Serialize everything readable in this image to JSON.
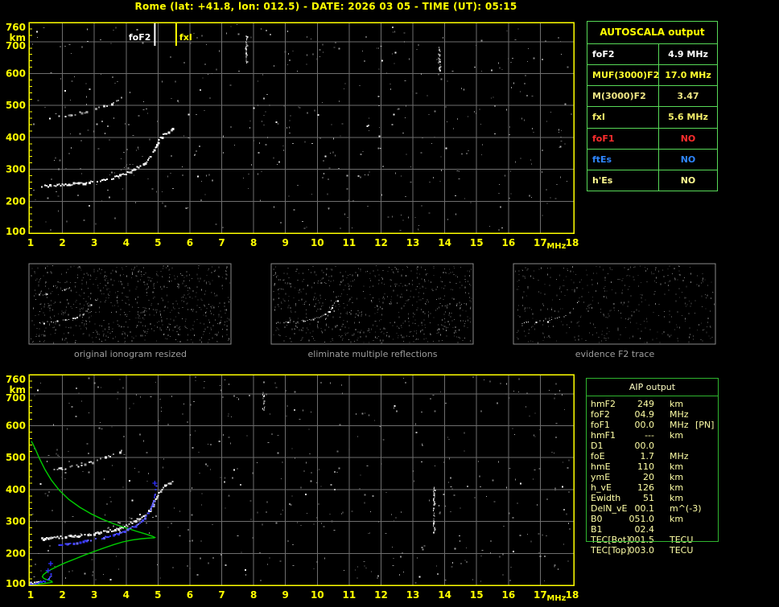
{
  "title": "Rome (lat: +41.8, lon: 012.5) - DATE: 2026 03 05 - TIME (UT): 05:15",
  "colors": {
    "background": "#000000",
    "axis": "#ffff00",
    "grid": "#6e6e6e",
    "trace_white": "#ffffff",
    "trace_gray": "#999999",
    "profile_green": "#00cf00",
    "fitted_blue": "#2f2fff",
    "table_border_autoscala": "#57d957",
    "table_border_aip": "#2fb52f",
    "aip_text": "#ffffa6",
    "caption_gray": "#9e9e9e",
    "foF2_marker": "#ffffff",
    "fxI_marker": "#ffff00"
  },
  "axes": {
    "freq_unit": "MHz",
    "freq_ticks": [
      1,
      2,
      3,
      4,
      5,
      6,
      7,
      8,
      9,
      10,
      11,
      12,
      13,
      14,
      15,
      16,
      17,
      18
    ],
    "height_unit": "km",
    "height_ticks": [
      760,
      700,
      600,
      500,
      400,
      300,
      200,
      100
    ],
    "freq_range": [
      1,
      18
    ],
    "height_range": [
      100,
      760
    ]
  },
  "markers": {
    "foF2": {
      "label": "foF2",
      "freq_mhz": 4.9
    },
    "fxI": {
      "label": "fxI",
      "freq_mhz": 5.57
    }
  },
  "autoscala_table": {
    "header": "AUTOSCALA output",
    "rows": [
      {
        "label": "foF2",
        "value": "4.9 MHz",
        "color": "#ffffff"
      },
      {
        "label": "MUF(3000)F2",
        "value": "17.0 MHz",
        "color": "#ffff2e"
      },
      {
        "label": "M(3000)F2",
        "value": "3.47",
        "color": "#efe685"
      },
      {
        "label": "fxI",
        "value": "5.6 MHz",
        "color": "#f5ef6a"
      },
      {
        "label": "foF1",
        "value": "NO",
        "color": "#ff2d2d"
      },
      {
        "label": "ftEs",
        "value": "NO",
        "color": "#2e86ff"
      },
      {
        "label": "h'Es",
        "value": "NO",
        "color": "#fdf98f"
      }
    ]
  },
  "aip_table": {
    "header": "AIP output",
    "rows": [
      {
        "label": "hmF2",
        "value": "249",
        "unit": "km",
        "extra": ""
      },
      {
        "label": "foF2",
        "value": "04.9",
        "unit": "MHz",
        "extra": ""
      },
      {
        "label": "foF1",
        "value": "00.0",
        "unit": "MHz",
        "extra": "[PN]"
      },
      {
        "label": "hmF1",
        "value": "---",
        "unit": "km",
        "extra": ""
      },
      {
        "label": "D1",
        "value": "00.0",
        "unit": "",
        "extra": ""
      },
      {
        "label": "foE",
        "value": "1.7",
        "unit": "MHz",
        "extra": ""
      },
      {
        "label": "hmE",
        "value": "110",
        "unit": "km",
        "extra": ""
      },
      {
        "label": "ymE",
        "value": "20",
        "unit": "km",
        "extra": ""
      },
      {
        "label": "h_vE",
        "value": "126",
        "unit": "km",
        "extra": ""
      },
      {
        "label": "Ewidth",
        "value": "51",
        "unit": "km",
        "extra": ""
      },
      {
        "label": "DelN_vE",
        "value": "00.1",
        "unit": "m^(-3)",
        "extra": ""
      },
      {
        "label": "B0",
        "value": "051.0",
        "unit": "km",
        "extra": ""
      },
      {
        "label": "B1",
        "value": "02.4",
        "unit": "",
        "extra": ""
      },
      {
        "label": "TEC[Bot]",
        "value": "001.5",
        "unit": "TECU",
        "extra": ""
      },
      {
        "label": "TEC[Top]",
        "value": "003.0",
        "unit": "TECU",
        "extra": ""
      }
    ]
  },
  "panels": [
    {
      "caption": "original ionogram resized"
    },
    {
      "caption": "eliminate multiple reflections"
    },
    {
      "caption": "evidence F2 trace"
    }
  ],
  "chart_data": {
    "type": "scatter",
    "title": "Autoscala ionogram scaling - Rome 2026-03-05 05:15 UT",
    "xlabel": "MHz",
    "ylabel": "km",
    "xlim": [
      1,
      18
    ],
    "ylim": [
      100,
      760
    ],
    "grid": true,
    "traces": {
      "f2_first_order_mhz_km": [
        [
          1.35,
          246
        ],
        [
          1.6,
          248
        ],
        [
          1.85,
          250
        ],
        [
          2.1,
          252
        ],
        [
          2.35,
          254
        ],
        [
          2.6,
          257
        ],
        [
          2.85,
          260
        ],
        [
          3.1,
          263
        ],
        [
          3.35,
          267
        ],
        [
          3.6,
          273
        ],
        [
          3.85,
          281
        ],
        [
          4.1,
          291
        ],
        [
          4.3,
          301
        ],
        [
          4.5,
          313
        ],
        [
          4.65,
          325
        ],
        [
          4.78,
          340
        ],
        [
          4.88,
          357
        ],
        [
          4.97,
          378
        ],
        [
          5.08,
          398
        ],
        [
          5.22,
          411
        ],
        [
          5.38,
          420
        ],
        [
          5.5,
          427
        ]
      ],
      "f2_second_order_mhz_km": [
        [
          1.55,
          458
        ],
        [
          1.8,
          462
        ],
        [
          2.05,
          466
        ],
        [
          2.3,
          470
        ],
        [
          2.55,
          475
        ],
        [
          2.8,
          481
        ],
        [
          3.05,
          488
        ],
        [
          3.3,
          497
        ],
        [
          3.55,
          507
        ],
        [
          3.75,
          516
        ],
        [
          3.9,
          524
        ]
      ],
      "o_mode_shadow_mhz_km": [
        [
          3.3,
          278
        ],
        [
          3.6,
          288
        ],
        [
          3.9,
          300
        ],
        [
          4.12,
          310
        ],
        [
          4.28,
          319
        ]
      ],
      "fitted_trace_blue_mhz_km": [
        [
          1.9,
          226
        ],
        [
          2.1,
          229
        ],
        [
          2.3,
          232
        ],
        [
          2.5,
          235
        ],
        [
          2.7,
          238
        ],
        [
          2.9,
          241
        ],
        [
          3.1,
          245
        ],
        [
          3.3,
          249
        ],
        [
          3.5,
          254
        ],
        [
          3.7,
          260
        ],
        [
          3.9,
          267
        ],
        [
          4.1,
          276
        ],
        [
          4.3,
          287
        ],
        [
          4.48,
          300
        ],
        [
          4.62,
          315
        ],
        [
          4.74,
          332
        ],
        [
          4.83,
          352
        ],
        [
          4.89,
          375
        ],
        [
          4.93,
          398
        ],
        [
          4.96,
          415
        ]
      ],
      "fitted_e_region_blue_mhz_km": [
        [
          1.0,
          102
        ],
        [
          1.1,
          104
        ],
        [
          1.2,
          106
        ],
        [
          1.3,
          108
        ],
        [
          1.4,
          111
        ],
        [
          1.5,
          115
        ],
        [
          1.58,
          121
        ],
        [
          1.64,
          131
        ],
        [
          1.66,
          142
        ]
      ],
      "e_region_white_mhz_km": [
        [
          1.0,
          107
        ],
        [
          1.12,
          108
        ],
        [
          1.25,
          109
        ],
        [
          1.38,
          110
        ]
      ],
      "blue_plus_markers_mhz_km": [
        [
          1.55,
          146
        ],
        [
          1.63,
          168
        ],
        [
          4.9,
          420
        ]
      ],
      "electron_density_profile_green_mhz_km": [
        [
          1.07,
          100
        ],
        [
          1.1,
          103
        ],
        [
          1.25,
          104
        ],
        [
          1.45,
          106
        ],
        [
          1.6,
          108
        ],
        [
          1.68,
          110
        ],
        [
          1.66,
          113
        ],
        [
          1.55,
          116
        ],
        [
          1.47,
          119
        ],
        [
          1.4,
          123
        ],
        [
          1.37,
          127
        ],
        [
          1.4,
          133
        ],
        [
          1.5,
          141
        ],
        [
          1.65,
          150
        ],
        [
          1.85,
          160
        ],
        [
          2.1,
          171
        ],
        [
          2.4,
          183
        ],
        [
          2.7,
          195
        ],
        [
          3.0,
          206
        ],
        [
          3.3,
          217
        ],
        [
          3.6,
          227
        ],
        [
          3.9,
          236
        ],
        [
          4.2,
          242
        ],
        [
          4.5,
          246
        ],
        [
          4.75,
          248
        ],
        [
          4.88,
          249
        ],
        [
          4.9,
          250
        ],
        [
          4.82,
          254
        ],
        [
          4.6,
          261
        ],
        [
          4.3,
          270
        ],
        [
          3.95,
          281
        ],
        [
          3.6,
          293
        ],
        [
          3.25,
          307
        ],
        [
          2.9,
          324
        ],
        [
          2.55,
          344
        ],
        [
          2.2,
          369
        ],
        [
          1.9,
          398
        ],
        [
          1.65,
          430
        ],
        [
          1.45,
          463
        ],
        [
          1.28,
          497
        ],
        [
          1.15,
          527
        ],
        [
          1.06,
          545
        ],
        [
          1.02,
          552
        ]
      ]
    },
    "interference_streaks": {
      "top_plot": [
        {
          "mhz": 13.82,
          "km": [
            600,
            692
          ]
        },
        {
          "mhz": 7.76,
          "km": [
            636,
            722
          ]
        }
      ],
      "bottom_plot": [
        {
          "mhz": 13.65,
          "km": [
            268,
            410
          ]
        },
        {
          "mhz": 8.3,
          "km": [
            652,
            716
          ]
        }
      ]
    }
  }
}
